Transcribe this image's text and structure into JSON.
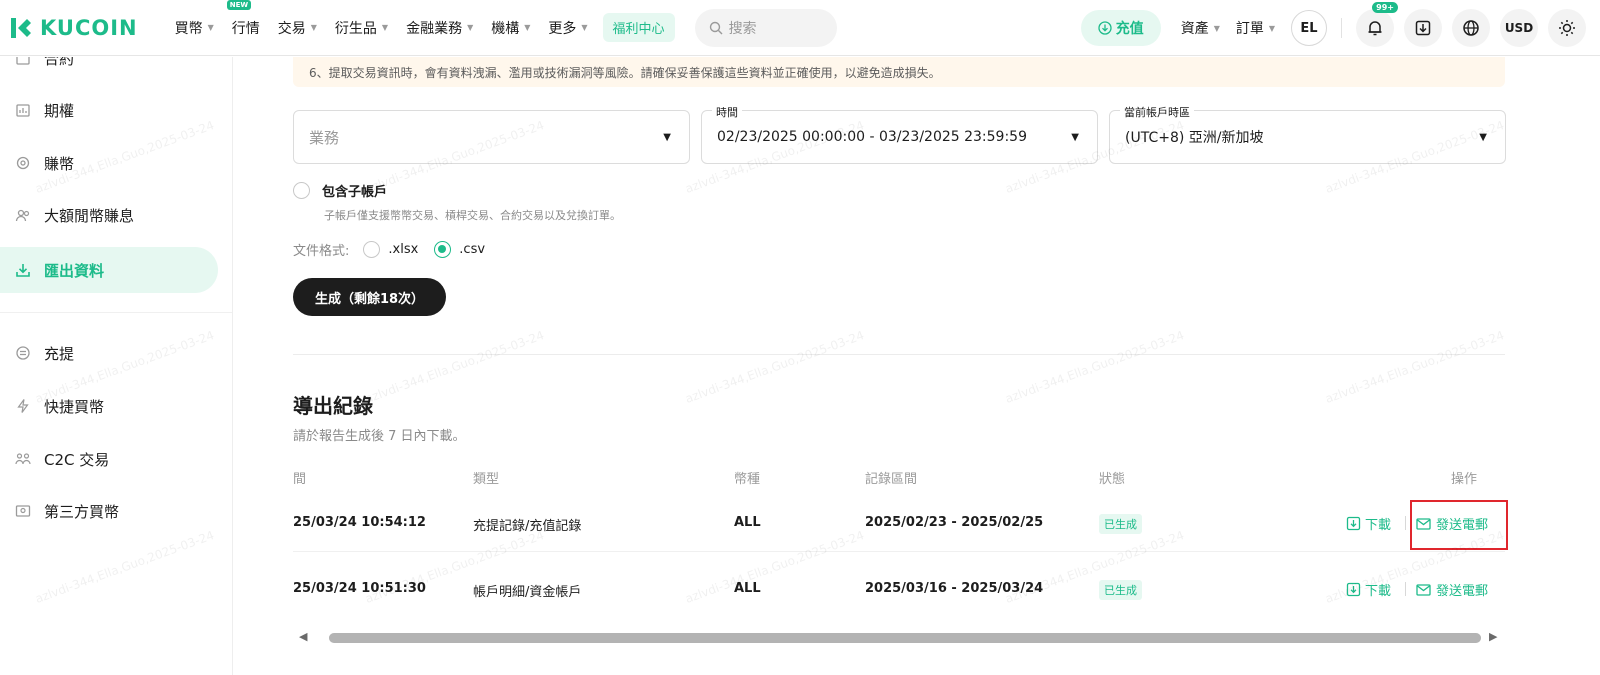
{
  "brand": {
    "logo_text": "KUCOIN",
    "accent": "#1dbb8a"
  },
  "nav": {
    "items": [
      {
        "label": "買幣",
        "caret": true
      },
      {
        "label": "行情",
        "caret": false,
        "badge": "NEW"
      },
      {
        "label": "交易",
        "caret": true
      },
      {
        "label": "衍生品",
        "caret": true
      },
      {
        "label": "金融業務",
        "caret": true
      },
      {
        "label": "機構",
        "caret": true
      },
      {
        "label": "更多",
        "caret": true
      }
    ],
    "welfare": "福利中心",
    "search_placeholder": "搜索",
    "deposit": "充值",
    "assets": "資產",
    "orders": "訂單",
    "avatar": "EL",
    "notif_badge": "99+",
    "currency": "USD"
  },
  "sidebar": {
    "items": [
      {
        "label": "合約",
        "icon": "contract-icon",
        "active": false
      },
      {
        "label": "期權",
        "icon": "options-icon",
        "active": false
      },
      {
        "label": "賺幣",
        "icon": "earn-icon",
        "active": false
      },
      {
        "label": "大額閒幣賺息",
        "icon": "users-icon",
        "active": false
      },
      {
        "label": "匯出資料",
        "icon": "download-icon",
        "active": true
      },
      {
        "label": "充提",
        "icon": "transfer-icon",
        "active": false
      },
      {
        "label": "快捷買幣",
        "icon": "lightning-icon",
        "active": false
      },
      {
        "label": "C2C 交易",
        "icon": "c2c-icon",
        "active": false
      },
      {
        "label": "第三方買幣",
        "icon": "card-icon",
        "active": false
      }
    ]
  },
  "notice": "6、提取交易資訊時，會有資料洩漏、濫用或技術漏洞等風險。請確保妥善保護這些資料並正確使用，以避免造成損失。",
  "form": {
    "business_placeholder": "業務",
    "time_label": "時間",
    "time_value": "02/23/2025 00:00:00 - 03/23/2025 23:59:59",
    "tz_label": "當前帳戶時區",
    "tz_value": "(UTC+8) 亞洲/新加坡",
    "include_sub": "包含子帳戶",
    "include_sub_hint": "子帳戶僅支援幣幣交易、槓桿交易、合約交易以及兌換訂單。",
    "format_label": "文件格式:",
    "format_xlsx": ".xlsx",
    "format_csv": ".csv",
    "format_selected": ".csv",
    "generate": "生成（剩餘18次）"
  },
  "records": {
    "title": "導出紀錄",
    "subtitle": "請於報告生成後 7 日內下載。",
    "columns": [
      "間",
      "類型",
      "幣種",
      "記錄區間",
      "狀態",
      "操作"
    ],
    "rows": [
      {
        "time": "25/03/24 10:54:12",
        "type": "充提記錄/充值記錄",
        "currency": "ALL",
        "range": "2025/02/23 - 2025/02/25",
        "status": "已生成",
        "download": "下載",
        "email": "發送電郵"
      },
      {
        "time": "25/03/24 10:51:30",
        "type": "帳戶明細/資金帳戶",
        "currency": "ALL",
        "range": "2025/03/16 - 2025/03/24",
        "status": "已生成",
        "download": "下載",
        "email": "發送電郵"
      }
    ]
  },
  "watermark": "azlvdi-344,Ella,Guo,2025-03-24"
}
